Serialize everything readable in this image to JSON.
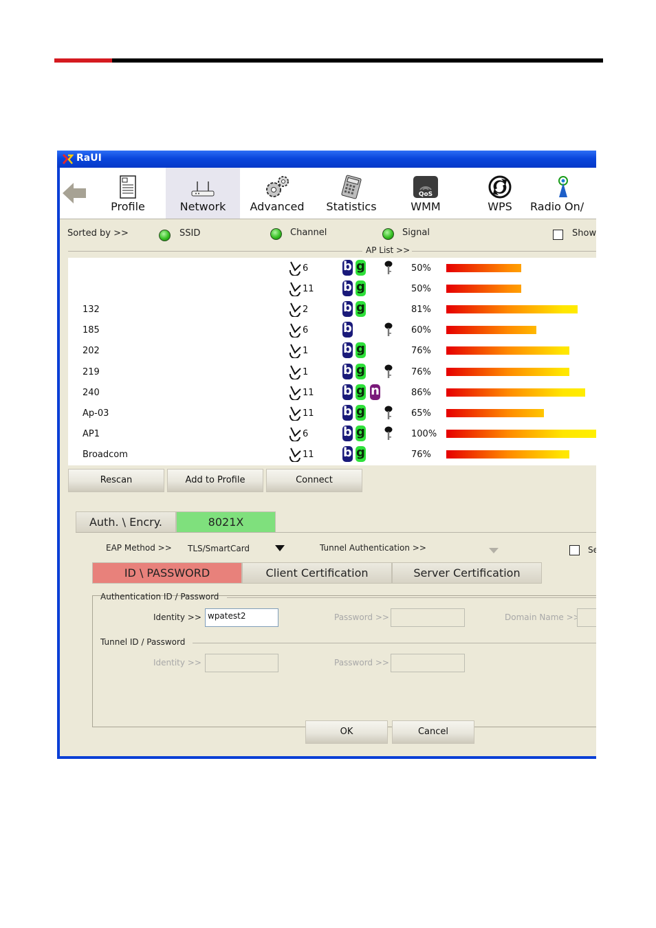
{
  "window": {
    "title": "RaUI"
  },
  "toolbar": {
    "items": [
      {
        "label": "Profile",
        "icon": "profile-icon"
      },
      {
        "label": "Network",
        "icon": "router-icon"
      },
      {
        "label": "Advanced",
        "icon": "gears-icon"
      },
      {
        "label": "Statistics",
        "icon": "calculator-icon"
      },
      {
        "label": "WMM",
        "icon": "qos-icon"
      },
      {
        "label": "WPS",
        "icon": "wps-icon"
      },
      {
        "label": "Radio On/",
        "icon": "antenna-icon"
      }
    ],
    "selected": "Network"
  },
  "sort": {
    "label": "Sorted by >>",
    "ssid": "SSID",
    "channel": "Channel",
    "signal": "Signal",
    "show": "Show"
  },
  "aplist": {
    "label": "AP List >>",
    "rows": [
      {
        "ssid": "",
        "channel": "6",
        "modes": [
          "b",
          "g"
        ],
        "secured": true,
        "signal": "50%",
        "signal_value": 50
      },
      {
        "ssid": "",
        "channel": "11",
        "modes": [
          "b",
          "g"
        ],
        "secured": false,
        "signal": "50%",
        "signal_value": 50
      },
      {
        "ssid": "132",
        "channel": "2",
        "modes": [
          "b",
          "g"
        ],
        "secured": false,
        "signal": "81%",
        "signal_value": 81
      },
      {
        "ssid": "185",
        "channel": "6",
        "modes": [
          "b"
        ],
        "secured": true,
        "signal": "60%",
        "signal_value": 60
      },
      {
        "ssid": "202",
        "channel": "1",
        "modes": [
          "b",
          "g"
        ],
        "secured": false,
        "signal": "76%",
        "signal_value": 76
      },
      {
        "ssid": "219",
        "channel": "1",
        "modes": [
          "b",
          "g"
        ],
        "secured": true,
        "signal": "76%",
        "signal_value": 76
      },
      {
        "ssid": "240",
        "channel": "11",
        "modes": [
          "b",
          "g",
          "n"
        ],
        "secured": false,
        "signal": "86%",
        "signal_value": 86
      },
      {
        "ssid": "Ap-03",
        "channel": "11",
        "modes": [
          "b",
          "g"
        ],
        "secured": true,
        "signal": "65%",
        "signal_value": 65
      },
      {
        "ssid": "AP1",
        "channel": "6",
        "modes": [
          "b",
          "g"
        ],
        "secured": true,
        "signal": "100%",
        "signal_value": 100
      },
      {
        "ssid": "Broadcom",
        "channel": "11",
        "modes": [
          "b",
          "g"
        ],
        "secured": false,
        "signal": "76%",
        "signal_value": 76
      }
    ]
  },
  "buttons": {
    "rescan": "Rescan",
    "add_profile": "Add to Profile",
    "connect": "Connect",
    "ok": "OK",
    "cancel": "Cancel"
  },
  "security_tabs": {
    "auth": "Auth. \\ Encry.",
    "x8021": "8021X"
  },
  "eap": {
    "label": "EAP Method >>",
    "value": "TLS/SmartCard",
    "tunnel_label": "Tunnel Authentication >>",
    "se_label": "Se"
  },
  "cert_tabs": {
    "id_password": "ID \\ PASSWORD",
    "client": "Client Certification",
    "server": "Server Certification"
  },
  "auth_group": {
    "title": "Authentication ID / Password",
    "identity_label": "Identity >>",
    "identity_value": "wpatest2",
    "password_label": "Password >>",
    "domain_label": "Domain Name >>"
  },
  "tunnel_group": {
    "title": "Tunnel ID / Password",
    "identity_label": "Identity >>",
    "password_label": "Password >>"
  },
  "colors": {
    "accent_red": "#d51a20",
    "tab_selected_red": "#e8817b",
    "tab_green": "#7fe07d",
    "title_blue": "#0a46dc"
  }
}
